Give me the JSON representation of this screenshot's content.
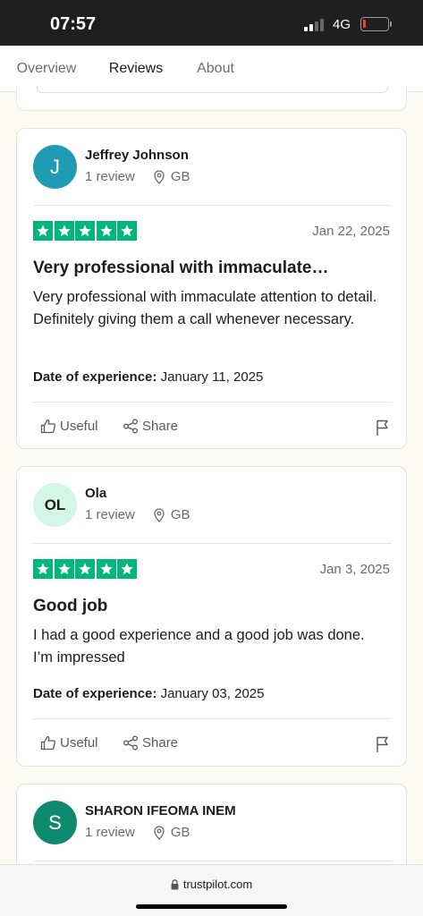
{
  "status_bar": {
    "time": "07:57",
    "network": "4G"
  },
  "tabs": [
    {
      "label": "Overview",
      "active": false
    },
    {
      "label": "Reviews",
      "active": true
    },
    {
      "label": "About",
      "active": false
    }
  ],
  "reviews": [
    {
      "avatar_initials": "J",
      "avatar_color": "#1f9bb3",
      "name": "Jeffrey Johnson",
      "review_count": "1 review",
      "country": "GB",
      "rating": 5,
      "date": "Jan 22, 2025",
      "title": "Very professional with immaculate…",
      "body": "Very professional with immaculate attention to detail. Definitely giving them a call whenever necessary.",
      "experience_label": "Date of experience:",
      "experience_date": "January 11, 2025",
      "useful_label": "Useful",
      "share_label": "Share"
    },
    {
      "avatar_initials": "OL",
      "avatar_color": "#d4f6e8",
      "name": "Ola",
      "review_count": "1 review",
      "country": "GB",
      "rating": 5,
      "date": "Jan 3, 2025",
      "title": "Good job",
      "body": "I had a good experience and a good job was done. I’m impressed",
      "experience_label": "Date of experience:",
      "experience_date": "January 03, 2025",
      "useful_label": "Useful",
      "share_label": "Share"
    },
    {
      "avatar_initials": "S",
      "avatar_color": "#0e8a6e",
      "name": "SHARON IFEOMA INEM",
      "review_count": "1 review",
      "country": "GB"
    }
  ],
  "browser": {
    "url": "trustpilot.com"
  },
  "colors": {
    "star_green": "#00b67a",
    "tab_underline": "#1c1c3c"
  }
}
